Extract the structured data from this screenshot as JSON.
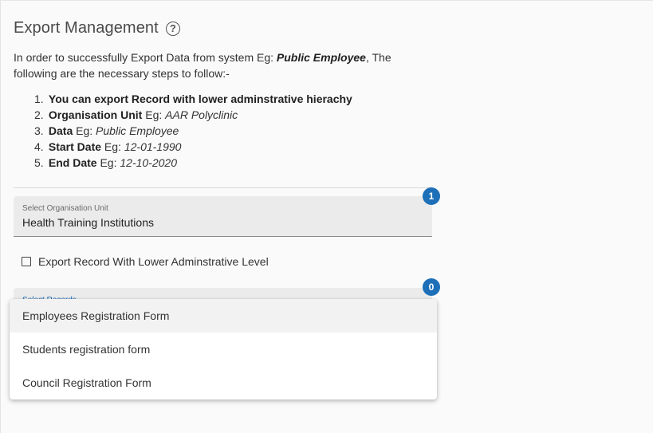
{
  "header": {
    "title": "Export Management",
    "help_icon": "?"
  },
  "intro": {
    "text_before": "In order to successfully Export Data from system Eg: ",
    "emphasis": "Public Employee",
    "text_after": ", The following are the necessary steps to follow:-"
  },
  "steps": [
    {
      "num": "1.",
      "key": "You can export Record with lower adminstrative hierachy",
      "mid": "",
      "value": ""
    },
    {
      "num": "2.",
      "key": "Organisation Unit",
      "mid": " Eg: ",
      "value": "AAR Polyclinic"
    },
    {
      "num": "3.",
      "key": "Data",
      "mid": " Eg: ",
      "value": "Public Employee"
    },
    {
      "num": "4.",
      "key": "Start Date",
      "mid": " Eg: ",
      "value": "12-01-1990"
    },
    {
      "num": "5.",
      "key": "End Date",
      "mid": " Eg: ",
      "value": "12-10-2020"
    }
  ],
  "org_unit": {
    "badge": "1",
    "label": "Select Organisation Unit",
    "value": "Health Training Institutions"
  },
  "lower_level": {
    "label": "Export Record With Lower Adminstrative Level",
    "checked": false
  },
  "records": {
    "badge": "0",
    "label": "Select Records",
    "options": [
      "Employees Registration Form",
      "Students registration form",
      "Council Registration Form"
    ]
  },
  "colors": {
    "badge": "#1d6fb8",
    "field_bg": "#ebebeb"
  }
}
